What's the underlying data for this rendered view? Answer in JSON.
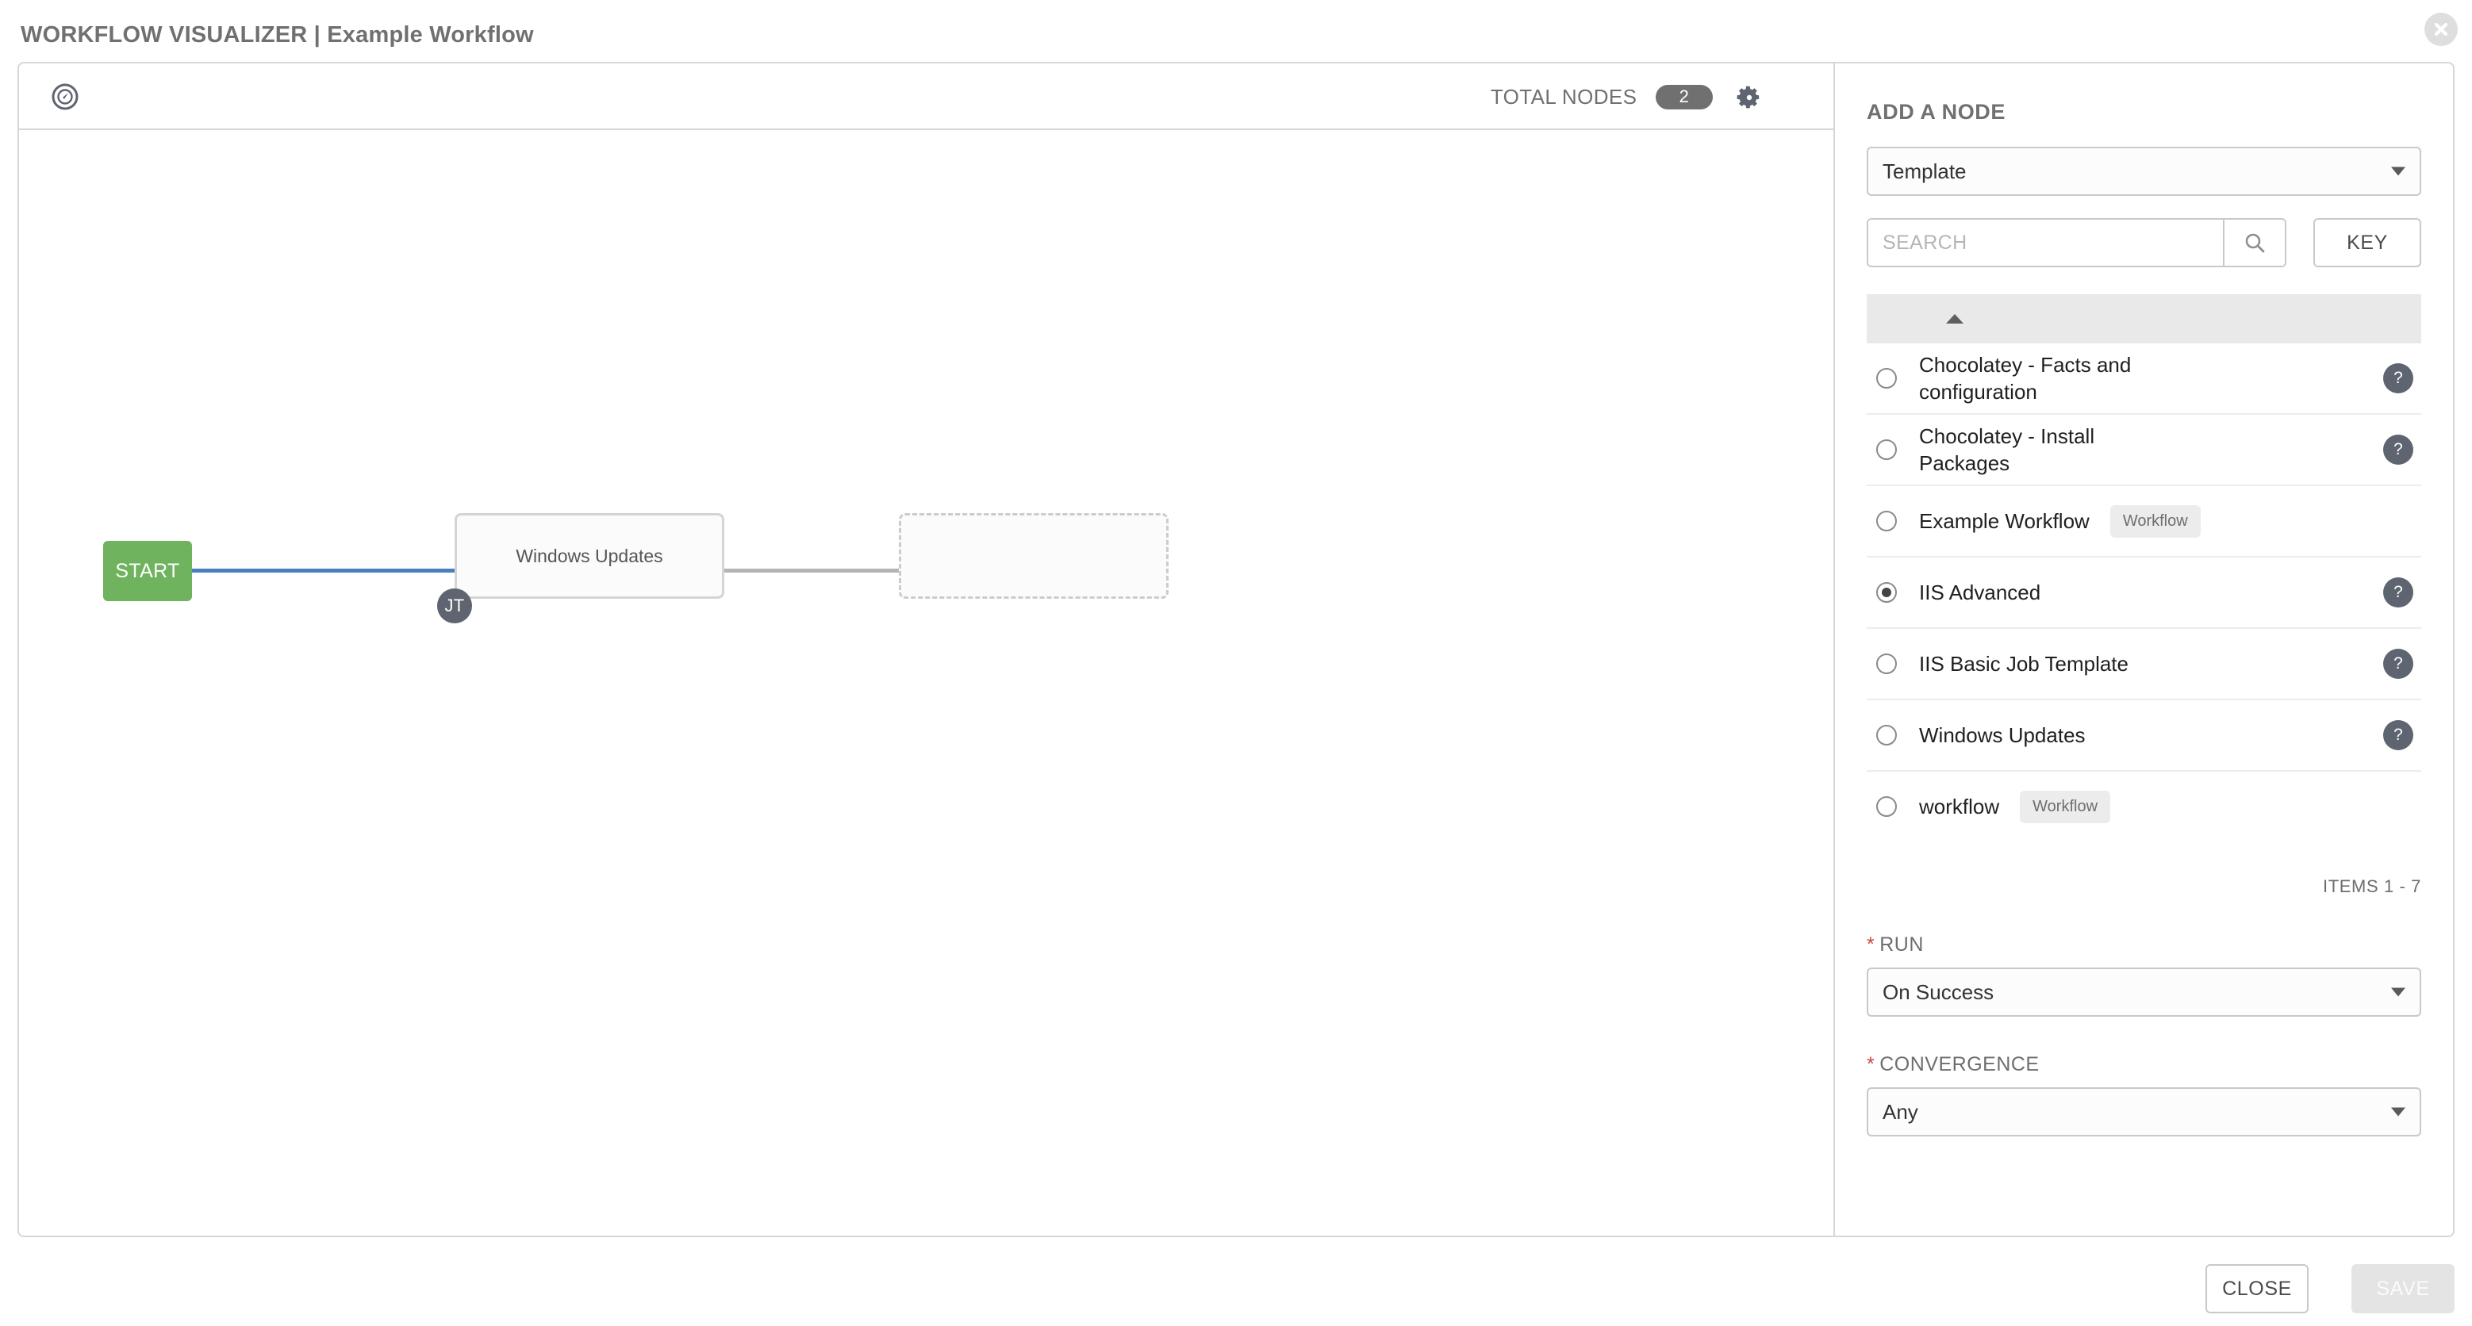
{
  "header": {
    "title": "WORKFLOW VISUALIZER | Example Workflow",
    "close_icon": "close-circle-icon"
  },
  "canvas": {
    "toolbar": {
      "compass_icon": "compass-icon",
      "total_nodes_label": "TOTAL NODES",
      "total_nodes_count": "2",
      "settings_icon": "gear-icon"
    },
    "graph": {
      "start_label": "START",
      "start_color": "#6fb35f",
      "edge_active_color": "#4a7fbd",
      "edge_inactive_color": "#b4b4b4",
      "nodes": [
        {
          "label": "Windows Updates",
          "badge": "JT",
          "type": "job-template"
        }
      ],
      "placeholder_node": {
        "label": "",
        "type": "placeholder"
      }
    }
  },
  "panel": {
    "title": "ADD A NODE",
    "node_type": {
      "selected": "Template",
      "caret_icon": "chevron-down-icon"
    },
    "search": {
      "placeholder": "SEARCH",
      "value": "",
      "search_icon": "search-icon",
      "key_button": "KEY"
    },
    "list": {
      "sort_icon": "sort-ascending-icon",
      "items": [
        {
          "label": "Chocolatey - Facts and configuration",
          "selected": false,
          "tag": "",
          "help": "?"
        },
        {
          "label": "Chocolatey - Install Packages",
          "selected": false,
          "tag": "",
          "help": "?"
        },
        {
          "label": "Example Workflow",
          "selected": false,
          "tag": "Workflow",
          "help": ""
        },
        {
          "label": "IIS Advanced",
          "selected": true,
          "tag": "",
          "help": "?"
        },
        {
          "label": "IIS Basic Job Template",
          "selected": false,
          "tag": "",
          "help": "?"
        },
        {
          "label": "Windows Updates",
          "selected": false,
          "tag": "",
          "help": "?"
        },
        {
          "label": "workflow",
          "selected": false,
          "tag": "Workflow",
          "help": ""
        }
      ],
      "items_count": "ITEMS  1 - 7"
    },
    "run": {
      "label": "RUN",
      "required_marker": "*",
      "selected": "On Success"
    },
    "convergence": {
      "label": "CONVERGENCE",
      "required_marker": "*",
      "selected": "Any"
    }
  },
  "footer": {
    "close_label": "CLOSE",
    "save_label": "SAVE"
  }
}
